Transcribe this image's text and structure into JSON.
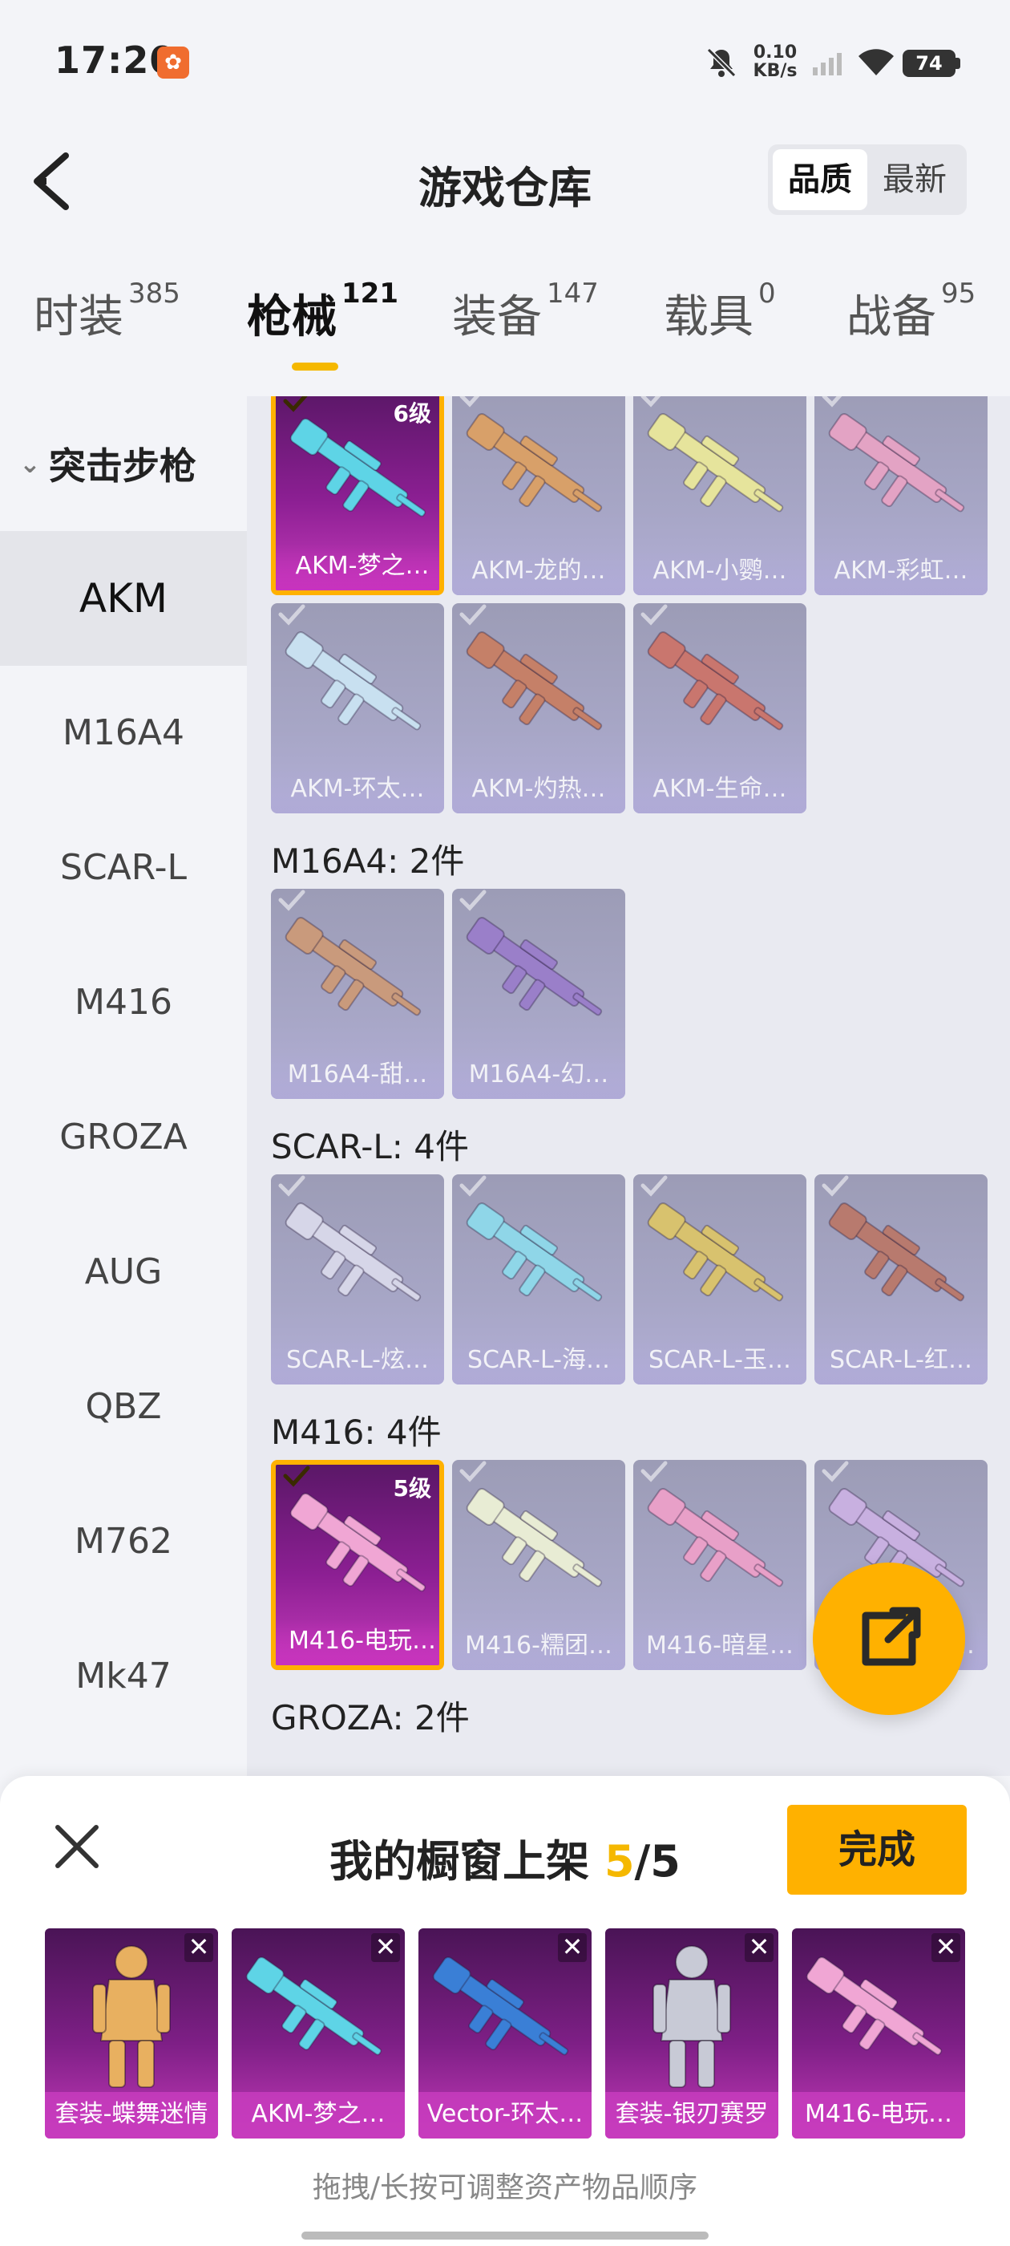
{
  "status": {
    "time": "17:20",
    "app_badge": "✿",
    "net_speed": "0.10",
    "net_unit": "KB/s",
    "battery": "74"
  },
  "header": {
    "title": "游戏仓库",
    "sort_options": [
      "品质",
      "最新"
    ],
    "active_sort": "品质"
  },
  "tabs": [
    {
      "label": "时装",
      "count": "385"
    },
    {
      "label": "枪械",
      "count": "121"
    },
    {
      "label": "装备",
      "count": "147"
    },
    {
      "label": "载具",
      "count": "0"
    },
    {
      "label": "战备",
      "count": "95"
    }
  ],
  "sidebar": {
    "category": "突击步枪",
    "items": [
      "AKM",
      "M16A4",
      "SCAR-L",
      "M416",
      "GROZA",
      "AUG",
      "QBZ",
      "M762",
      "Mk47"
    ]
  },
  "sections": [
    {
      "title": "",
      "items": [
        {
          "label": "AKM-梦之…",
          "level": "6级",
          "selected": true,
          "color": "#5ed4e6"
        },
        {
          "label": "AKM-龙的…",
          "selected": false,
          "color": "#d8a069"
        },
        {
          "label": "AKM-小鹦…",
          "selected": false,
          "color": "#e6e49c"
        },
        {
          "label": "AKM-彩虹…",
          "selected": false,
          "color": "#e3a3c4"
        },
        {
          "label": "AKM-环太…",
          "selected": false,
          "color": "#c8e0f0"
        },
        {
          "label": "AKM-灼热…",
          "selected": false,
          "color": "#c58068"
        },
        {
          "label": "AKM-生命…",
          "selected": false,
          "color": "#c9766e"
        }
      ]
    },
    {
      "title": "M16A4: 2件",
      "items": [
        {
          "label": "M16A4-甜…",
          "selected": false,
          "color": "#c99a7c"
        },
        {
          "label": "M16A4-幻…",
          "selected": false,
          "color": "#9a7fc9"
        }
      ]
    },
    {
      "title": "SCAR-L: 4件",
      "items": [
        {
          "label": "SCAR-L-炫…",
          "selected": false,
          "color": "#d6d6e8"
        },
        {
          "label": "SCAR-L-海…",
          "selected": false,
          "color": "#8fd6e8"
        },
        {
          "label": "SCAR-L-玉…",
          "selected": false,
          "color": "#d8c26e"
        },
        {
          "label": "SCAR-L-红…",
          "selected": false,
          "color": "#b87a6e"
        }
      ]
    },
    {
      "title": "M416: 4件",
      "items": [
        {
          "label": "M416-电玩…",
          "level": "5级",
          "selected": true,
          "color": "#f0a6d4"
        },
        {
          "label": "M416-糯团…",
          "selected": false,
          "color": "#e8ecd4"
        },
        {
          "label": "M416-暗星…",
          "selected": false,
          "color": "#e8a0c8"
        },
        {
          "label": "M416-…色…",
          "selected": false,
          "color": "#c8b0e0"
        }
      ]
    },
    {
      "title": "GROZA: 2件",
      "items": []
    }
  ],
  "panel": {
    "title_prefix": "我的橱窗上架",
    "current": "5",
    "total": "/5",
    "done_label": "完成",
    "shelf": [
      {
        "label": "套装-蝶舞迷情",
        "type": "outfit",
        "color": "#e8b060"
      },
      {
        "label": "AKM-梦之…",
        "type": "gun",
        "color": "#5ed4e6"
      },
      {
        "label": "Vector-环太…",
        "type": "gun",
        "color": "#3a7fd6"
      },
      {
        "label": "套装-银刃赛罗",
        "type": "outfit",
        "color": "#c8cad6"
      },
      {
        "label": "M416-电玩…",
        "type": "gun",
        "color": "#f0a6d4"
      }
    ],
    "hint": "拖拽/长按可调整资产物品顺序"
  },
  "icons": {
    "back": "chevron-left-icon",
    "share": "share-icon",
    "close": "close-icon",
    "remove": "remove-icon",
    "check": "check-icon"
  }
}
